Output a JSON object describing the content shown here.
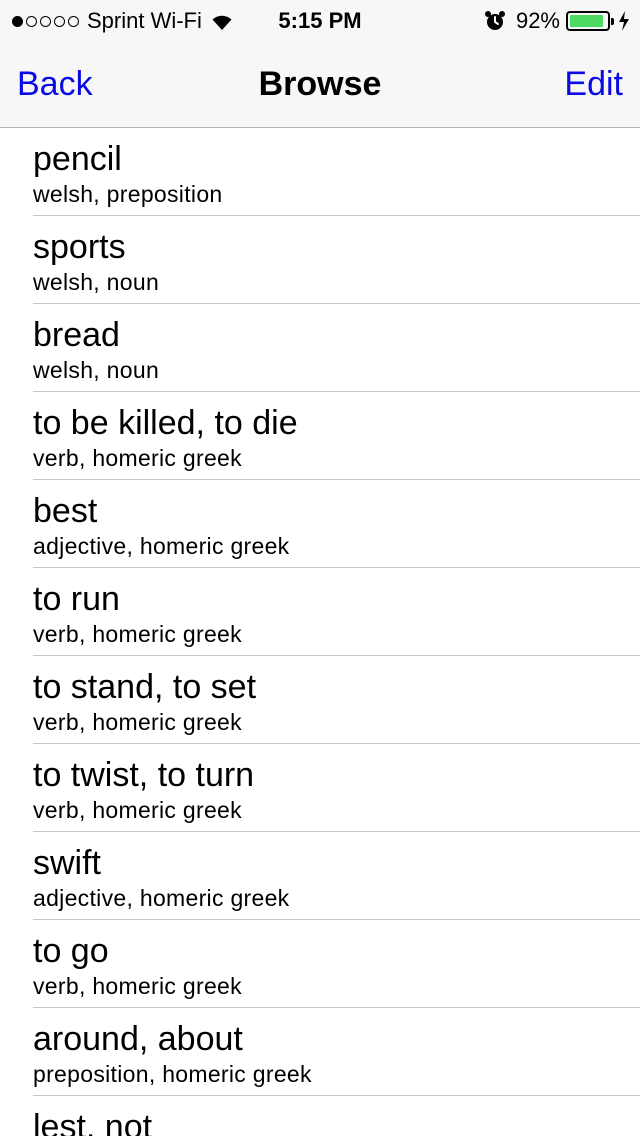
{
  "status_bar": {
    "carrier": "Sprint Wi-Fi",
    "signal_bars_filled": 1,
    "signal_bars_total": 5,
    "time": "5:15 PM",
    "battery_percent": "92%",
    "battery_level": 0.92,
    "battery_color": "#4cd964"
  },
  "nav": {
    "back_label": "Back",
    "title": "Browse",
    "edit_label": "Edit",
    "tint_color": "#0a0ae6"
  },
  "entries": [
    {
      "word": "pencil",
      "details": "welsh, preposition"
    },
    {
      "word": "sports",
      "details": "welsh, noun"
    },
    {
      "word": "bread",
      "details": "welsh, noun"
    },
    {
      "word": "to be killed, to die",
      "details": "verb, homeric greek"
    },
    {
      "word": "best",
      "details": "adjective, homeric greek"
    },
    {
      "word": "to run",
      "details": "verb, homeric greek"
    },
    {
      "word": "to stand, to set",
      "details": "verb, homeric greek"
    },
    {
      "word": "to twist, to turn",
      "details": "verb, homeric greek"
    },
    {
      "word": "swift",
      "details": "adjective, homeric greek"
    },
    {
      "word": "to go",
      "details": "verb, homeric greek"
    },
    {
      "word": "around, about",
      "details": "preposition, homeric greek"
    },
    {
      "word": "lest, not",
      "details": ""
    }
  ]
}
